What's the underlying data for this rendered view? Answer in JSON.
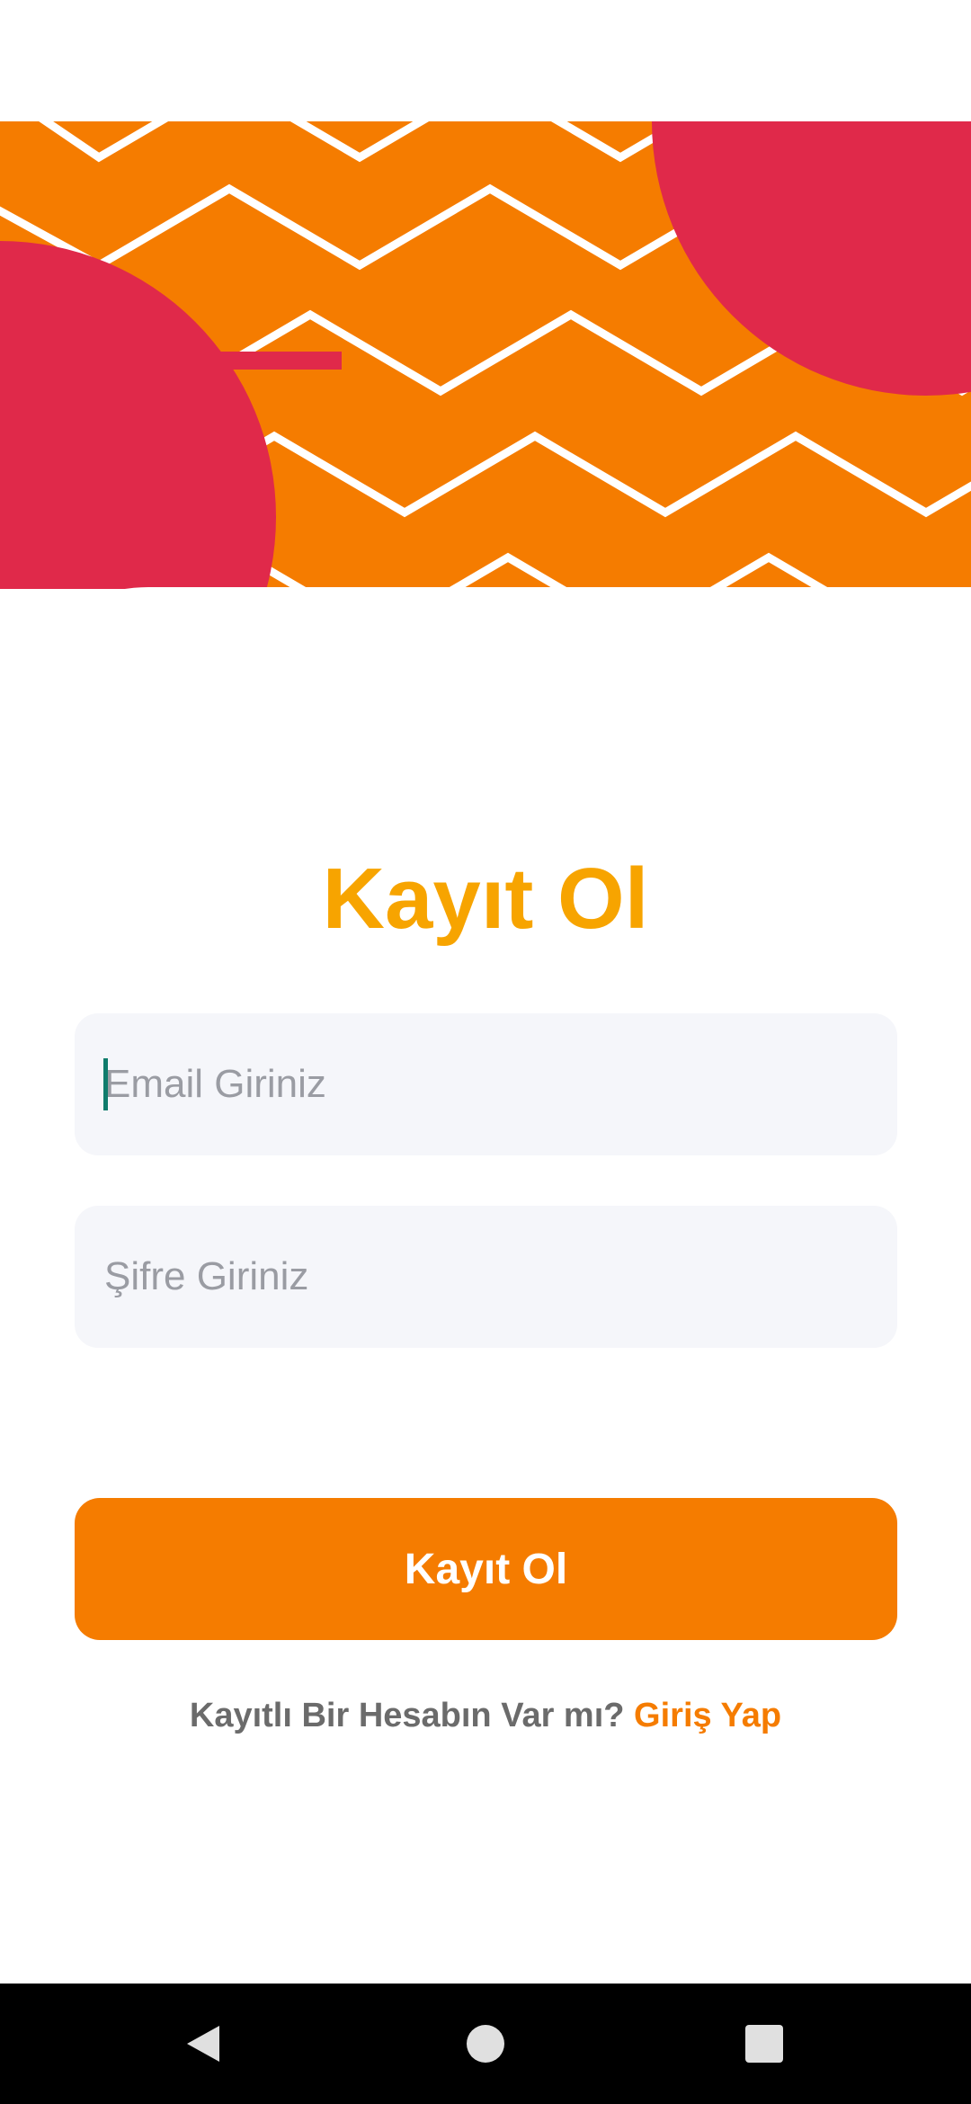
{
  "colors": {
    "accent_orange": "#f57c00",
    "title_orange": "#f7a400",
    "blob_red": "#e0294a",
    "pattern_orange": "#f57c00",
    "field_background": "#f5f6fa",
    "muted_text": "#6b6b6b",
    "placeholder": "#9a9ca3"
  },
  "header": {
    "title": "Kayıt Ol"
  },
  "form": {
    "email_placeholder": "Email Giriniz",
    "password_placeholder": "Şifre Giriniz",
    "submit_label": "Kayıt Ol"
  },
  "footer": {
    "question": "Kayıtlı Bir Hesabın Var mı?",
    "login_link": "Giriş Yap"
  },
  "navigation": {
    "back": "back-icon",
    "home": "home-icon",
    "recents": "recents-icon"
  }
}
